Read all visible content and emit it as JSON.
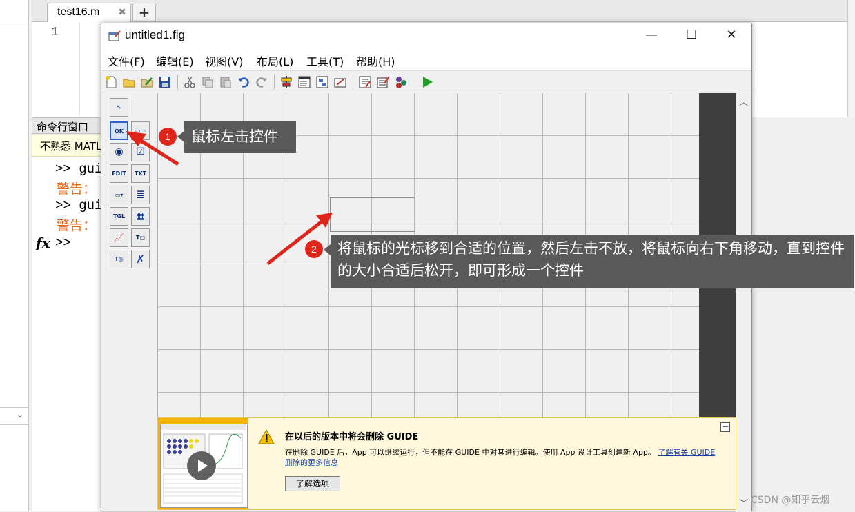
{
  "editor": {
    "tab_label": "test16.m",
    "tab_close": "✖",
    "add_tab": "+",
    "line_number": "1"
  },
  "command_window": {
    "title": "命令行窗口",
    "info_bar": "不熟悉 MATLAB？请参阅有关快速入门的资源。",
    "lines": [
      {
        "prompt": ">>",
        "text": "gui",
        "type": "cmd"
      },
      {
        "prompt": "",
        "text": "警告：",
        "type": "warn"
      },
      {
        "prompt": ">>",
        "text": "gui",
        "type": "cmd"
      },
      {
        "prompt": "",
        "text": "警告：",
        "type": "warn"
      },
      {
        "prompt": ">>",
        "text": "",
        "type": "cmd"
      }
    ],
    "fx_label": "fx"
  },
  "figure_window": {
    "title": "untitled1.fig",
    "minimize": "—",
    "maximize": "☐",
    "close": "✕",
    "menus": [
      "文件(F)",
      "编辑(E)",
      "视图(V)",
      "布局(L)",
      "工具(T)",
      "帮助(H)"
    ]
  },
  "palette": {
    "items": [
      {
        "name": "select-tool",
        "label": "↖"
      },
      {
        "name": "push-button-tool",
        "label": "OK"
      },
      {
        "name": "slider-tool",
        "label": "▭▭"
      },
      {
        "name": "radio-button-tool",
        "label": "◉"
      },
      {
        "name": "checkbox-tool",
        "label": "☑"
      },
      {
        "name": "edit-text-tool",
        "label": "EDIT"
      },
      {
        "name": "static-text-tool",
        "label": "TXT"
      },
      {
        "name": "popup-menu-tool",
        "label": "▭▾"
      },
      {
        "name": "listbox-tool",
        "label": "≣"
      },
      {
        "name": "toggle-button-tool",
        "label": "TGL"
      },
      {
        "name": "table-tool",
        "label": "▦"
      },
      {
        "name": "axes-tool",
        "label": "📈"
      },
      {
        "name": "panel-tool",
        "label": "T▢"
      },
      {
        "name": "button-group-tool",
        "label": "T◎"
      },
      {
        "name": "activex-tool",
        "label": "✗"
      }
    ]
  },
  "banner": {
    "title": "在以后的版本中将会删除 GUIDE",
    "text": "在删除 GUIDE 后，App 可以继续运行，但不能在 GUIDE 中对其进行编辑。使用 App 设计工具创建新 App。",
    "link": "了解有关 GUIDE 删除的更多信息",
    "button": "了解选项",
    "collapse": "−"
  },
  "annotations": {
    "step1_num": "1",
    "step1_text": "鼠标左击控件",
    "step2_num": "2",
    "step2_text": "将鼠标的光标移到合适的位置，然后左击不放，将鼠标向右下角移动，直到控件的大小合适后松开，即可形成一个控件"
  },
  "watermark": "CSDN @知乎云烟",
  "colors": {
    "accent_red": "#e0261b",
    "callout_bg": "#595959",
    "banner_bg": "#fff8dc",
    "warning_text": "#e46a1e"
  }
}
